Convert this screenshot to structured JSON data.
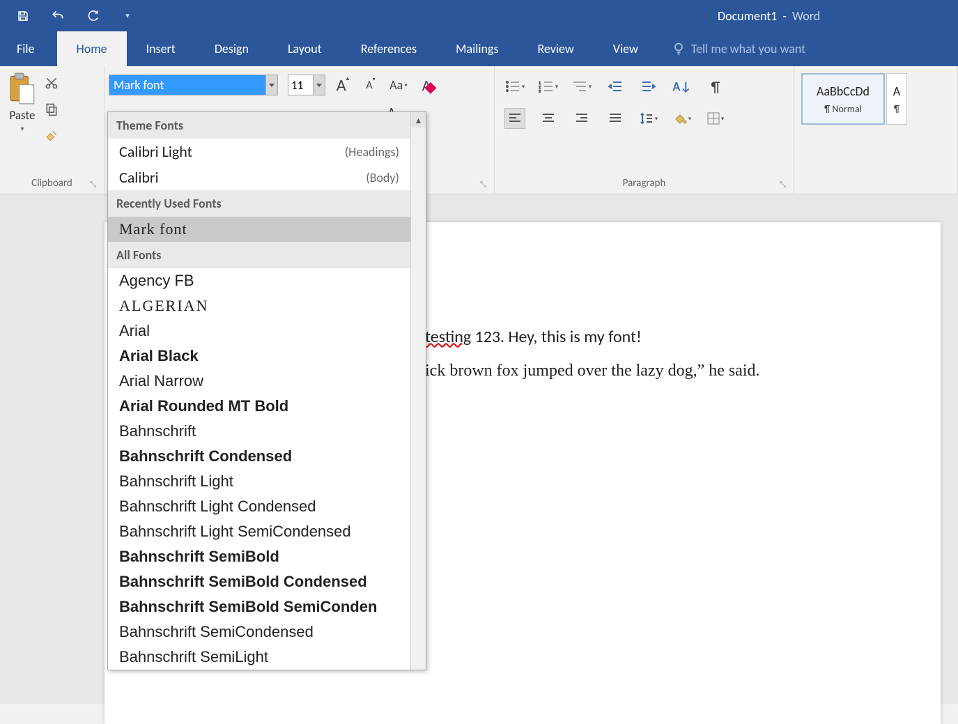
{
  "titlebar": {
    "doc_name": "Document1",
    "sep": "-",
    "app_name": "Word"
  },
  "tabs": {
    "file": "File",
    "home": "Home",
    "insert": "Insert",
    "design": "Design",
    "layout": "Layout",
    "references": "References",
    "mailings": "Mailings",
    "review": "Review",
    "view": "View",
    "tellme": "Tell me what you want"
  },
  "ribbon": {
    "clipboard": {
      "label": "Clipboard",
      "paste": "Paste"
    },
    "font": {
      "name_value": "Mark font",
      "size_value": "11",
      "grow": "A",
      "shrink": "A",
      "case": "Aa",
      "clear": "A"
    },
    "paragraph": {
      "label": "Paragraph"
    },
    "styles": {
      "sample": "AaBbCcDd",
      "normal": "¶ Normal",
      "sample2": "A",
      "extra": "¶"
    }
  },
  "dropdown": {
    "hdr_theme": "Theme Fonts",
    "theme": [
      {
        "name": "Calibri Light",
        "hint": "(Headings)",
        "cls": "ff-calibri-light"
      },
      {
        "name": "Calibri",
        "hint": "(Body)",
        "cls": "ff-calibri"
      }
    ],
    "hdr_recent": "Recently Used Fonts",
    "recent": [
      {
        "name": "Mark font",
        "cls": "ff-mark",
        "hover": true
      }
    ],
    "hdr_all": "All Fonts",
    "all": [
      {
        "name": "Agency FB",
        "cls": "ff-agency"
      },
      {
        "name": "ALGERIAN",
        "cls": "ff-algerian"
      },
      {
        "name": "Arial",
        "cls": "ff-arial"
      },
      {
        "name": "Arial Black",
        "cls": "ff-arial-black"
      },
      {
        "name": "Arial Narrow",
        "cls": "ff-arial-narrow"
      },
      {
        "name": "Arial Rounded MT Bold",
        "cls": "ff-arial-round"
      },
      {
        "name": "Bahnschrift",
        "cls": "ff-bahn"
      },
      {
        "name": "Bahnschrift Condensed",
        "cls": "ff-bahn-cond"
      },
      {
        "name": "Bahnschrift Light",
        "cls": "ff-bahn-light"
      },
      {
        "name": "Bahnschrift Light Condensed",
        "cls": "ff-bahn-light-cond"
      },
      {
        "name": "Bahnschrift Light SemiCondensed",
        "cls": "ff-bahn-light-scond"
      },
      {
        "name": "Bahnschrift SemiBold",
        "cls": "ff-bahn-sb"
      },
      {
        "name": "Bahnschrift SemiBold Condensed",
        "cls": "ff-bahn-sb-cond"
      },
      {
        "name": "Bahnschrift SemiBold SemiConden",
        "cls": "ff-bahn-sb-scond"
      },
      {
        "name": "Bahnschrift SemiCondensed",
        "cls": "ff-bahn-scond"
      },
      {
        "name": "Bahnschrift SemiLight",
        "cls": "ff-bahn-sl"
      }
    ]
  },
  "document": {
    "line1_a": "testing",
    "line1_b": " 123. Hey, this is my font!",
    "line2": "ick brown fox jumped over the lazy dog,” he said."
  }
}
